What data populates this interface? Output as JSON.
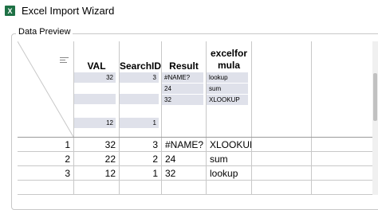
{
  "window": {
    "title": "Excel Import Wizard",
    "icon": "excel-icon"
  },
  "group": {
    "label": "Data Preview"
  },
  "columns": [
    {
      "name": "VAL"
    },
    {
      "name": "SearchID"
    },
    {
      "name": "Result"
    },
    {
      "name": "excelformula"
    }
  ],
  "column_stats": {
    "val": [
      "32",
      "",
      "",
      "12"
    ],
    "searchid": [
      "3",
      "",
      "",
      "1"
    ],
    "result": [
      "#NAME?",
      "24",
      "32"
    ],
    "excelformula": [
      "lookup",
      "sum",
      "XLOOKUP"
    ]
  },
  "rows": [
    {
      "num": "1",
      "val": "32",
      "searchid": "3",
      "result": "#NAME?",
      "formula": "XLOOKUP"
    },
    {
      "num": "2",
      "val": "22",
      "searchid": "2",
      "result": "24",
      "formula": "sum"
    },
    {
      "num": "3",
      "val": "12",
      "searchid": "1",
      "result": "32",
      "formula": "lookup"
    }
  ],
  "colors": {
    "stat_box": "#dfe1ea",
    "grid_line": "#c8c8c8",
    "icon_green": "#1e7145"
  }
}
